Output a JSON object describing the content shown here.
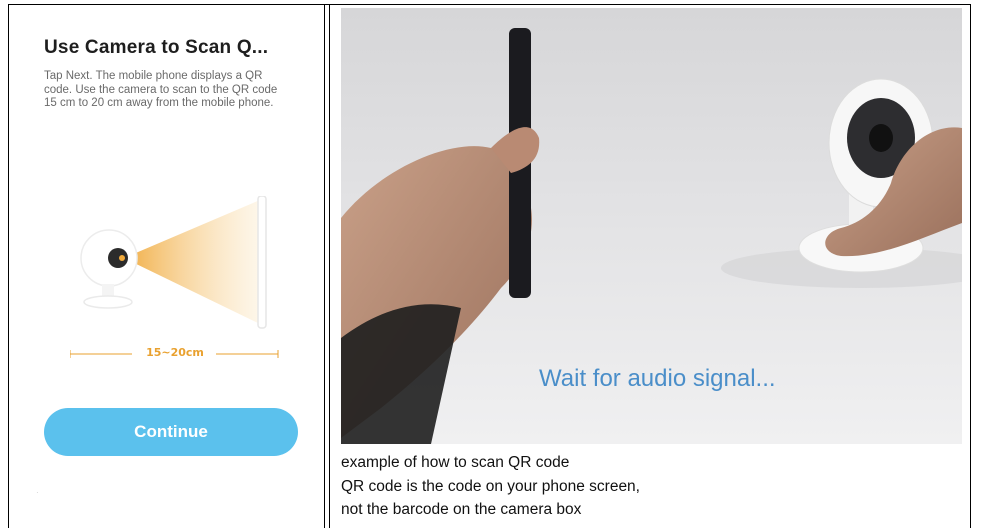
{
  "phone": {
    "title": "Use Camera to Scan Q...",
    "description": "Tap Next. The mobile phone displays a QR code. Use the camera to scan to the QR code 15 cm to 20 cm away from the mobile phone.",
    "distance_label": "15~20cm",
    "continue_label": "Continue",
    "accent_color": "#5bc1ed",
    "beam_color": "#f3b44a"
  },
  "photo": {
    "overlay_text": "Wait for audio signal..."
  },
  "caption": {
    "lines": [
      "example of how to scan QR code",
      "QR code is the code on your phone screen,",
      "not the barcode on the camera box"
    ]
  }
}
